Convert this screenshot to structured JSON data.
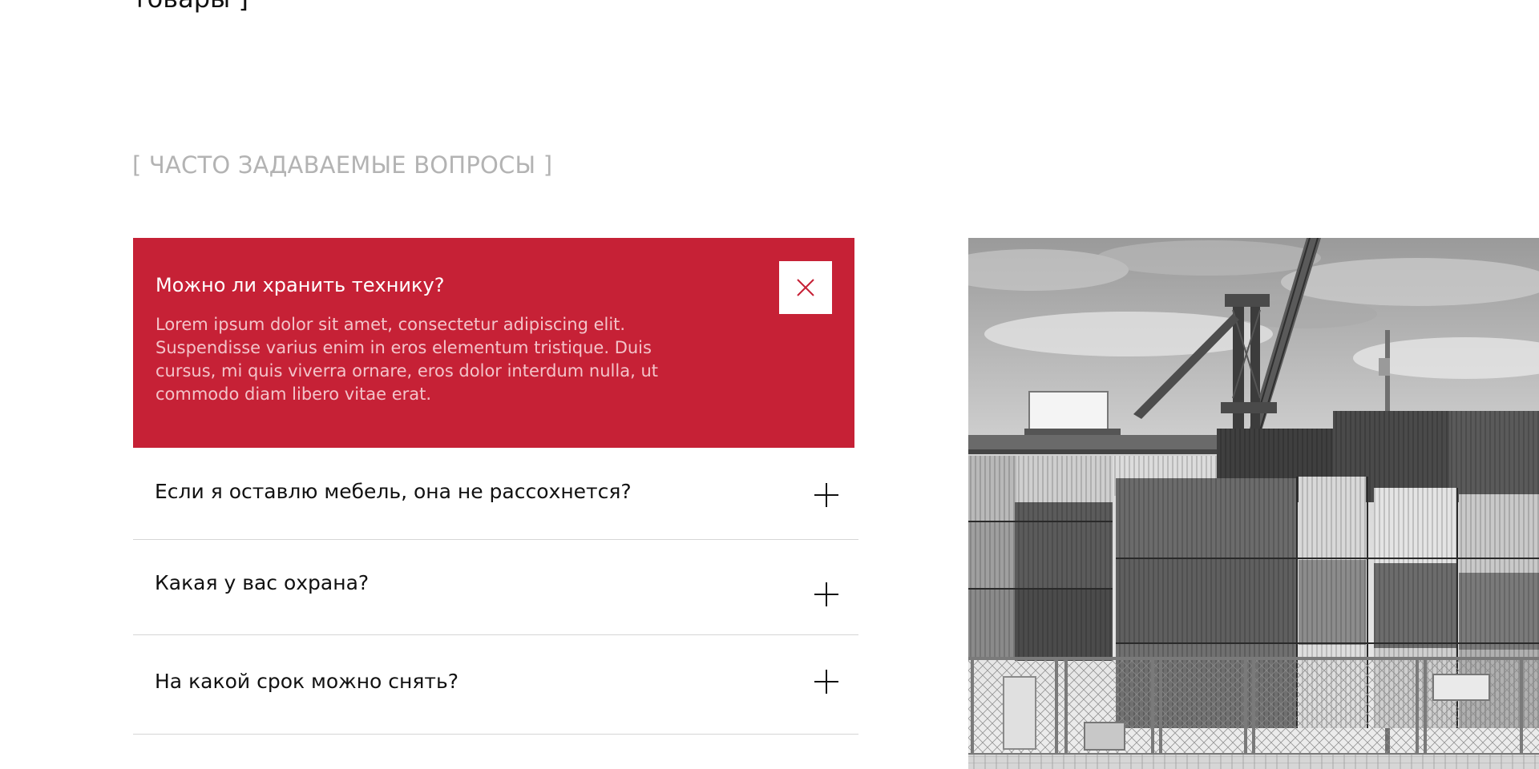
{
  "previous_section": {
    "heading_tail": "товары ]"
  },
  "faq": {
    "section_label": "[ ЧАСТО ЗАДАВАЕМЫЕ ВОПРОСЫ ]",
    "open_item": {
      "question": "Можно ли хранить технику?",
      "answer": "Lorem ipsum dolor sit amet, consectetur adipiscing elit. Suspendisse varius enim in eros elementum tristique. Duis cursus, mi quis viverra ornare, eros dolor interdum nulla, ut commodo diam libero vitae erat.",
      "toggle_icon": "close-icon"
    },
    "items": [
      {
        "question": "Если я оставлю мебель, она не рассохнется?",
        "toggle_icon": "plus-icon"
      },
      {
        "question": "Какая у вас охрана?",
        "toggle_icon": "plus-icon"
      },
      {
        "question": "На какой срок можно снять?",
        "toggle_icon": "plus-icon"
      }
    ]
  },
  "colors": {
    "accent": "#c62136",
    "label_gray": "#b3b3b3",
    "divider": "#d6d6d6",
    "answer_text": "#f3c3c9"
  },
  "image": {
    "subject": "container-yard-photo",
    "style": "grayscale"
  }
}
